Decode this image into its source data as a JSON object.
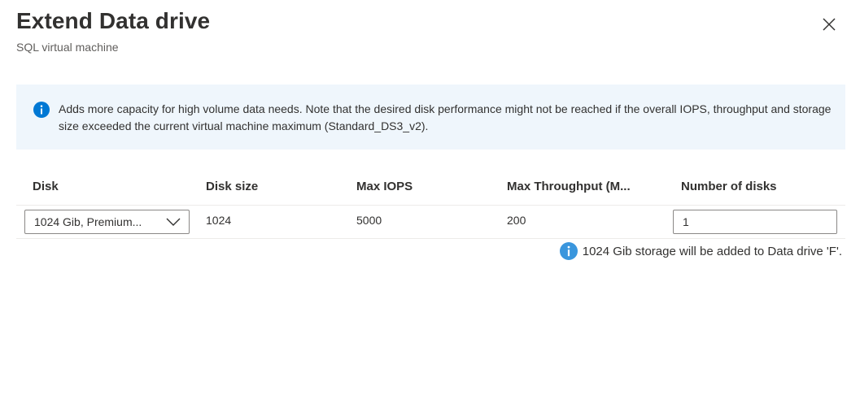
{
  "header": {
    "title": "Extend Data drive",
    "subtitle": "SQL virtual machine",
    "close_icon": "close-icon"
  },
  "banner": {
    "icon": "info-icon",
    "text": "Adds more capacity for high volume data needs. Note that the desired disk performance might not be reached if the overall IOPS, throughput and storage size exceeded the current virtual machine maximum (Standard_DS3_v2)."
  },
  "grid": {
    "columns": {
      "disk": "Disk",
      "disk_size": "Disk size",
      "max_iops": "Max IOPS",
      "max_throughput": "Max Throughput (M...",
      "number_of_disks": "Number of disks"
    },
    "row": {
      "disk": "1024 Gib, Premium...",
      "disk_size": "1024",
      "max_iops": "5000",
      "max_throughput": "200",
      "number_of_disks": "1"
    }
  },
  "note": {
    "icon": "info-icon",
    "text": "1024 Gib storage will be added to Data drive 'F'."
  },
  "colors": {
    "banner_bg": "#eff6fc",
    "info_blue": "#0078d4",
    "note_icon_blue": "#3a96dd",
    "border": "#8a8886"
  }
}
